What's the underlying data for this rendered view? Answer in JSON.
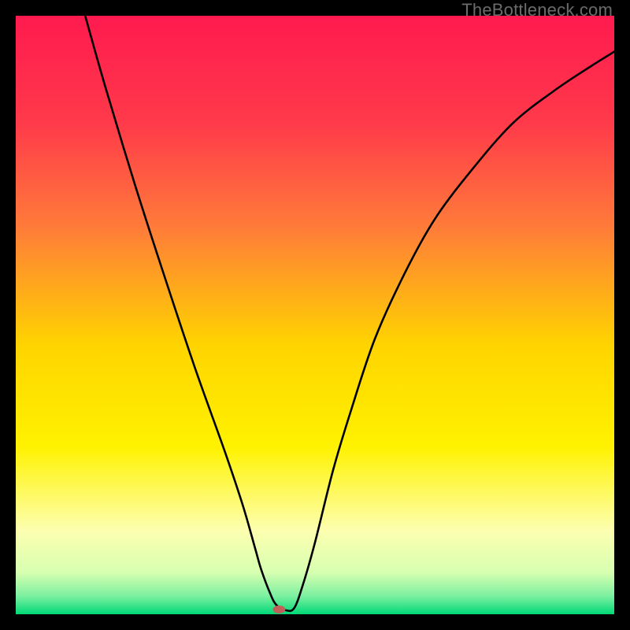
{
  "watermark": "TheBottleneck.com",
  "chart_data": {
    "type": "line",
    "title": "",
    "xlabel": "",
    "ylabel": "",
    "xlim": [
      0,
      100
    ],
    "ylim": [
      0,
      100
    ],
    "background_gradient": {
      "stops": [
        {
          "offset": 0.0,
          "color": "#ff1a4f"
        },
        {
          "offset": 0.18,
          "color": "#ff3a4a"
        },
        {
          "offset": 0.35,
          "color": "#ff7a3a"
        },
        {
          "offset": 0.55,
          "color": "#ffd400"
        },
        {
          "offset": 0.72,
          "color": "#fff200"
        },
        {
          "offset": 0.86,
          "color": "#fdffb0"
        },
        {
          "offset": 0.93,
          "color": "#d7ffb0"
        },
        {
          "offset": 0.97,
          "color": "#7bf0a0"
        },
        {
          "offset": 1.0,
          "color": "#00d977"
        }
      ]
    },
    "series": [
      {
        "name": "curve",
        "x": [
          11.6,
          15,
          20,
          25,
          30,
          35,
          38,
          40,
          41,
          42.5,
          43.5,
          45,
          46.5,
          48,
          50,
          53,
          56,
          60,
          65,
          70,
          76,
          83,
          90,
          96,
          100
        ],
        "y": [
          100,
          88,
          71.5,
          56,
          41,
          27,
          18,
          11,
          7.5,
          3.5,
          1.6,
          0.7,
          1.0,
          5,
          12,
          24,
          34,
          46,
          57,
          66,
          74,
          82,
          87.5,
          91.5,
          94
        ]
      }
    ],
    "marker": {
      "x": 44.0,
      "y": 0.8,
      "color": "#c06058",
      "rx": 8,
      "ry": 5
    }
  }
}
